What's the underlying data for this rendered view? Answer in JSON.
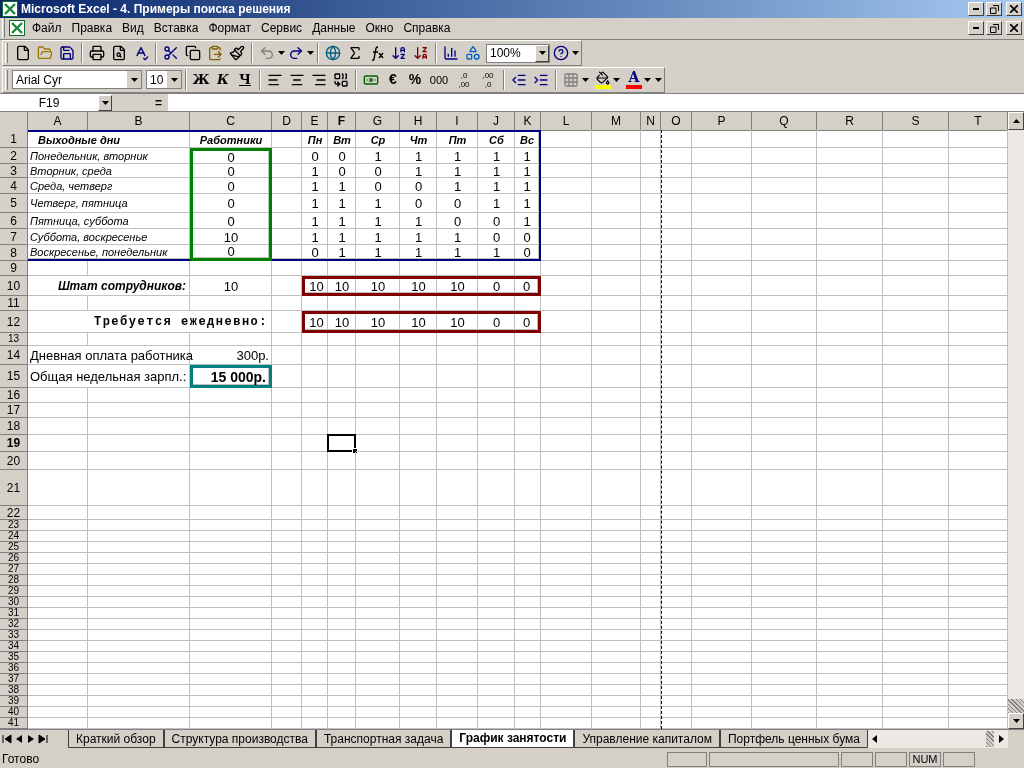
{
  "window": {
    "title": "Microsoft Excel - 4. Примеры поиска решения"
  },
  "menu": [
    "Файл",
    "Правка",
    "Вид",
    "Вставка",
    "Формат",
    "Сервис",
    "Данные",
    "Окно",
    "Справка"
  ],
  "toolbar_standard": {
    "zoom": "100%"
  },
  "toolbar_formatting": {
    "font": "Arial Cyr",
    "size": "10",
    "bold": "Ж",
    "italic": "К",
    "underline": "Ч",
    "euro": "€",
    "percent": "%",
    "thousands": "000",
    "increase_decimal": [
      ",0",
      ",00"
    ],
    "decrease_decimal": [
      ",00",
      ",0"
    ],
    "font_color": "A"
  },
  "formula_bar": {
    "name_box": "F19",
    "equals": "="
  },
  "sheet": {
    "columns": [
      {
        "label": "A",
        "active": false
      },
      {
        "label": "B",
        "active": false
      },
      {
        "label": "C",
        "active": false
      },
      {
        "label": "D",
        "active": false
      },
      {
        "label": "E",
        "active": false
      },
      {
        "label": "F",
        "active": true
      },
      {
        "label": "G",
        "active": false
      },
      {
        "label": "H",
        "active": false
      },
      {
        "label": "I",
        "active": false
      },
      {
        "label": "J",
        "active": false
      },
      {
        "label": "K",
        "active": false
      },
      {
        "label": "L",
        "active": false
      },
      {
        "label": "M",
        "active": false
      },
      {
        "label": "N",
        "active": false
      },
      {
        "label": "O",
        "active": false
      },
      {
        "label": "P",
        "active": false
      },
      {
        "label": "Q",
        "active": false
      },
      {
        "label": "R",
        "active": false
      },
      {
        "label": "S",
        "active": false
      },
      {
        "label": "T",
        "active": false
      }
    ],
    "rows": [
      {
        "number": "1",
        "active": false,
        "cells": {
          "A": {
            "text": "Выходные дни",
            "kind": "heading-left"
          },
          "C": {
            "text": "Работники",
            "kind": "heading"
          },
          "E": {
            "text": "Пн",
            "kind": "heading"
          },
          "F": {
            "text": "Вт",
            "kind": "heading"
          },
          "G": {
            "text": "Ср",
            "kind": "heading"
          },
          "H": {
            "text": "Чт",
            "kind": "heading"
          },
          "I": {
            "text": "Пт",
            "kind": "heading"
          },
          "J": {
            "text": "Сб",
            "kind": "heading"
          },
          "K": {
            "text": "Вс",
            "kind": "heading"
          }
        }
      },
      {
        "number": "2",
        "active": false,
        "cells": {
          "A": {
            "text": "Понедельник, вторник",
            "kind": "label"
          },
          "C": {
            "text": "0",
            "kind": "number"
          },
          "E": {
            "text": "0",
            "kind": "number"
          },
          "F": {
            "text": "0",
            "kind": "number"
          },
          "G": {
            "text": "1",
            "kind": "number"
          },
          "H": {
            "text": "1",
            "kind": "number"
          },
          "I": {
            "text": "1",
            "kind": "number"
          },
          "J": {
            "text": "1",
            "kind": "number"
          },
          "K": {
            "text": "1",
            "kind": "number"
          }
        }
      },
      {
        "number": "3",
        "active": false,
        "cells": {
          "A": {
            "text": "Вторник, среда",
            "kind": "label"
          },
          "C": {
            "text": "0",
            "kind": "number"
          },
          "E": {
            "text": "1",
            "kind": "number"
          },
          "F": {
            "text": "0",
            "kind": "number"
          },
          "G": {
            "text": "0",
            "kind": "number"
          },
          "H": {
            "text": "1",
            "kind": "number"
          },
          "I": {
            "text": "1",
            "kind": "number"
          },
          "J": {
            "text": "1",
            "kind": "number"
          },
          "K": {
            "text": "1",
            "kind": "number"
          }
        }
      },
      {
        "number": "4",
        "active": false,
        "cells": {
          "A": {
            "text": "Среда, четверг",
            "kind": "label"
          },
          "C": {
            "text": "0",
            "kind": "number"
          },
          "E": {
            "text": "1",
            "kind": "number"
          },
          "F": {
            "text": "1",
            "kind": "number"
          },
          "G": {
            "text": "0",
            "kind": "number"
          },
          "H": {
            "text": "0",
            "kind": "number"
          },
          "I": {
            "text": "1",
            "kind": "number"
          },
          "J": {
            "text": "1",
            "kind": "number"
          },
          "K": {
            "text": "1",
            "kind": "number"
          }
        }
      },
      {
        "number": "5",
        "active": false,
        "cells": {
          "A": {
            "text": "Четверг, пятница",
            "kind": "label"
          },
          "C": {
            "text": "0",
            "kind": "number"
          },
          "E": {
            "text": "1",
            "kind": "number"
          },
          "F": {
            "text": "1",
            "kind": "number"
          },
          "G": {
            "text": "1",
            "kind": "number"
          },
          "H": {
            "text": "0",
            "kind": "number"
          },
          "I": {
            "text": "0",
            "kind": "number"
          },
          "J": {
            "text": "1",
            "kind": "number"
          },
          "K": {
            "text": "1",
            "kind": "number"
          }
        }
      },
      {
        "number": "6",
        "active": false,
        "cells": {
          "A": {
            "text": "Пятница, суббота",
            "kind": "label"
          },
          "C": {
            "text": "0",
            "kind": "number"
          },
          "E": {
            "text": "1",
            "kind": "number"
          },
          "F": {
            "text": "1",
            "kind": "number"
          },
          "G": {
            "text": "1",
            "kind": "number"
          },
          "H": {
            "text": "1",
            "kind": "number"
          },
          "I": {
            "text": "0",
            "kind": "number"
          },
          "J": {
            "text": "0",
            "kind": "number"
          },
          "K": {
            "text": "1",
            "kind": "number"
          }
        }
      },
      {
        "number": "7",
        "active": false,
        "cells": {
          "A": {
            "text": "Суббота, воскресенье",
            "kind": "label"
          },
          "C": {
            "text": "10",
            "kind": "number"
          },
          "E": {
            "text": "1",
            "kind": "number"
          },
          "F": {
            "text": "1",
            "kind": "number"
          },
          "G": {
            "text": "1",
            "kind": "number"
          },
          "H": {
            "text": "1",
            "kind": "number"
          },
          "I": {
            "text": "1",
            "kind": "number"
          },
          "J": {
            "text": "0",
            "kind": "number"
          },
          "K": {
            "text": "0",
            "kind": "number"
          }
        }
      },
      {
        "number": "8",
        "active": false,
        "cells": {
          "A": {
            "text": "Воскресенье, понедельник",
            "kind": "label"
          },
          "C": {
            "text": "0",
            "kind": "number"
          },
          "E": {
            "text": "0",
            "kind": "number"
          },
          "F": {
            "text": "1",
            "kind": "number"
          },
          "G": {
            "text": "1",
            "kind": "number"
          },
          "H": {
            "text": "1",
            "kind": "number"
          },
          "I": {
            "text": "1",
            "kind": "number"
          },
          "J": {
            "text": "1",
            "kind": "number"
          },
          "K": {
            "text": "0",
            "kind": "number"
          }
        }
      },
      {
        "number": "9",
        "active": false
      },
      {
        "number": "10",
        "active": false,
        "cells": {
          "B": {
            "text": "Штат сотрудников:",
            "kind": "total-label"
          },
          "C": {
            "text": "10",
            "kind": "number"
          },
          "E": {
            "text": "10",
            "kind": "number"
          },
          "F": {
            "text": "10",
            "kind": "number"
          },
          "G": {
            "text": "10",
            "kind": "number"
          },
          "H": {
            "text": "10",
            "kind": "number"
          },
          "I": {
            "text": "10",
            "kind": "number"
          },
          "J": {
            "text": "0",
            "kind": "number"
          },
          "K": {
            "text": "0",
            "kind": "number"
          }
        }
      },
      {
        "number": "11",
        "active": false
      },
      {
        "number": "12",
        "active": false,
        "cells": {
          "C": {
            "text": "Требуется ежедневно:",
            "kind": "spaced-label"
          },
          "E": {
            "text": "10",
            "kind": "number"
          },
          "F": {
            "text": "10",
            "kind": "number"
          },
          "G": {
            "text": "10",
            "kind": "number"
          },
          "H": {
            "text": "10",
            "kind": "number"
          },
          "I": {
            "text": "10",
            "kind": "number"
          },
          "J": {
            "text": "0",
            "kind": "number"
          },
          "K": {
            "text": "0",
            "kind": "number"
          }
        }
      },
      {
        "number": "13",
        "active": false
      },
      {
        "number": "14",
        "active": false,
        "cells": {
          "A": {
            "text": "Дневная оплата работника",
            "kind": "text"
          },
          "C": {
            "text": "300р.",
            "kind": "money"
          }
        }
      },
      {
        "number": "15",
        "active": false,
        "cells": {
          "A": {
            "text": "Общая недельная зарпл.:",
            "kind": "text"
          },
          "C": {
            "text": "15 000р.",
            "kind": "total"
          }
        }
      },
      {
        "number": "16",
        "active": false
      },
      {
        "number": "17",
        "active": false
      },
      {
        "number": "18",
        "active": false
      },
      {
        "number": "19",
        "active": true
      },
      {
        "number": "20",
        "active": false
      },
      {
        "number": "21",
        "active": false
      },
      {
        "number": "22",
        "active": false
      },
      {
        "number": "23",
        "active": false
      },
      {
        "number": "24",
        "active": false
      },
      {
        "number": "25",
        "active": false
      },
      {
        "number": "26",
        "active": false
      },
      {
        "number": "27",
        "active": false
      },
      {
        "number": "28",
        "active": false
      },
      {
        "number": "29",
        "active": false
      },
      {
        "number": "30",
        "active": false
      },
      {
        "number": "31",
        "active": false
      },
      {
        "number": "32",
        "active": false
      },
      {
        "number": "33",
        "active": false
      },
      {
        "number": "34",
        "active": false
      },
      {
        "number": "35",
        "active": false
      },
      {
        "number": "36",
        "active": false
      },
      {
        "number": "37",
        "active": false
      },
      {
        "number": "38",
        "active": false
      },
      {
        "number": "39",
        "active": false
      },
      {
        "number": "40",
        "active": false
      },
      {
        "number": "41",
        "active": false
      }
    ]
  },
  "sheet_tabs": [
    {
      "label": "Краткий обзор",
      "selected": false
    },
    {
      "label": "Структура производства",
      "selected": false
    },
    {
      "label": "Транспортная задача",
      "selected": false
    },
    {
      "label": "График занятости",
      "selected": true
    },
    {
      "label": "Управление капиталом",
      "selected": false
    },
    {
      "label": "Портфель ценных бума",
      "selected": false
    }
  ],
  "status_bar": {
    "text": "Готово",
    "indicators": [
      "NUM"
    ]
  }
}
